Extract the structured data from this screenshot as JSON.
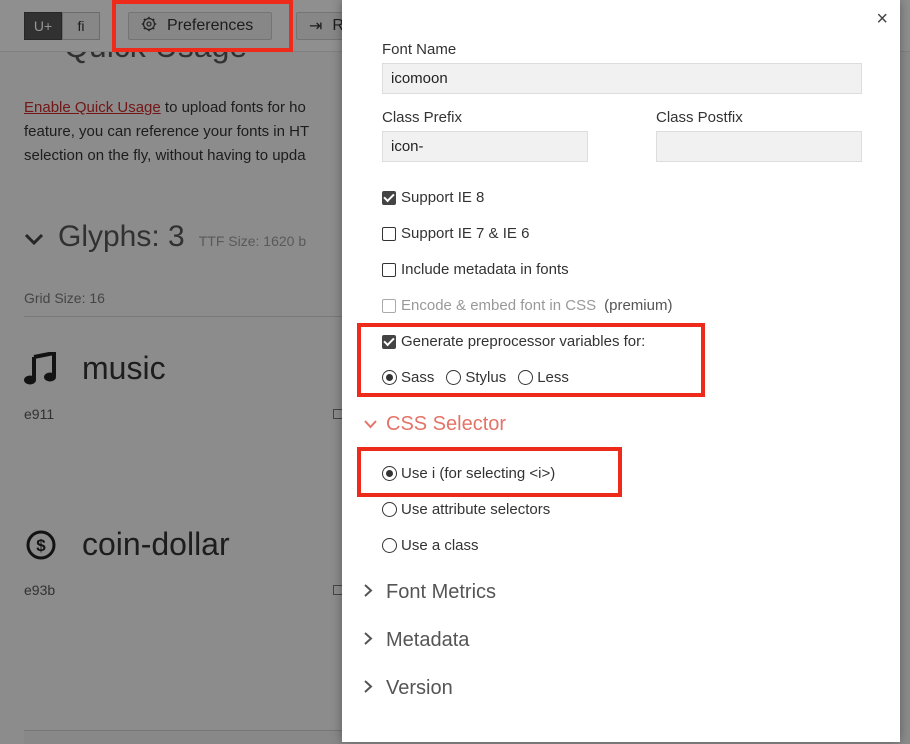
{
  "toolbar": {
    "unicode_btn": "U+",
    "ligature_btn": "fi",
    "preferences_label": "Preferences",
    "next_btn_partial": "R"
  },
  "background": {
    "section_title_partial": "Quick Usage",
    "link_text": "Enable Quick Usage",
    "para_line1": " to upload fonts for ho",
    "para_line2": "feature, you can reference your fonts in HT",
    "para_line3": "selection on the fly, without having to upda",
    "glyphs_title": "Glyphs: 3",
    "ttf_size": "TTF Size: 1620 b",
    "grid_size": "Grid Size: 16",
    "glyphs": [
      {
        "name": "music",
        "code": "e911",
        "icon": "music-icon"
      },
      {
        "name": "coin-dollar",
        "code": "e93b",
        "icon": "coin-dollar-icon"
      }
    ]
  },
  "modal": {
    "font_name_label": "Font Name",
    "font_name_value": "icomoon",
    "class_prefix_label": "Class Prefix",
    "class_prefix_value": "icon-",
    "class_postfix_label": "Class Postfix",
    "class_postfix_value": "",
    "options": [
      {
        "label": "Support IE 8",
        "checked": true
      },
      {
        "label": "Support IE 7 & IE 6",
        "checked": false
      },
      {
        "label": "Include metadata in fonts",
        "checked": false
      },
      {
        "label": "Encode & embed font in CSS",
        "checked": false,
        "note": "(premium)"
      },
      {
        "label": "Generate preprocessor variables for:",
        "checked": true
      }
    ],
    "preprocessors": [
      {
        "label": "Sass",
        "selected": true
      },
      {
        "label": "Stylus",
        "selected": false
      },
      {
        "label": "Less",
        "selected": false
      }
    ],
    "css_selector_title": "CSS Selector",
    "css_selector_options": [
      {
        "label": "Use i (for selecting <i>)",
        "selected": true
      },
      {
        "label": "Use attribute selectors",
        "selected": false
      },
      {
        "label": "Use a class",
        "selected": false
      }
    ],
    "sections": [
      "Font Metrics",
      "Metadata",
      "Version"
    ],
    "close": "×"
  },
  "colors": {
    "highlight": "#ee2a1a",
    "section_open": "#e57368",
    "link": "#c62828"
  }
}
